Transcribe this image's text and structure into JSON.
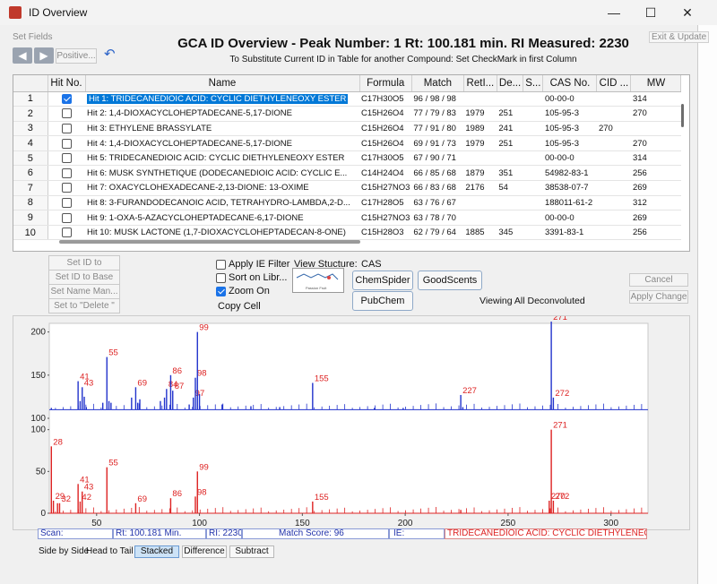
{
  "window": {
    "title": "ID Overview"
  },
  "toolbar": {
    "set_fields": "Set Fields",
    "positive": "Positive...",
    "exit_update": "Exit & Update"
  },
  "header": {
    "title": "GCA ID Overview - Peak Number: 1  Rt: 100.181 min.  RI Measured: 2230",
    "subtitle": "To Substitute Current ID in Table for another Compound: Set CheckMark in first Column"
  },
  "table": {
    "columns": [
      "",
      "Hit No.",
      "Name",
      "Formula",
      "Match",
      "RetI...",
      "De...",
      "S...",
      "CAS No.",
      "CID ...",
      "MW"
    ],
    "rows": [
      {
        "num": "1",
        "checked": true,
        "name": "Hit 1: TRIDECANEDIOIC ACID: CYCLIC DIETHYLENEOXY ESTER",
        "formula": "C17H30O5",
        "match": "96 / 98 / 98",
        "ret": "",
        "de": "",
        "s": "",
        "cas": "00-00-0",
        "cid": "",
        "mw": "314"
      },
      {
        "num": "2",
        "checked": false,
        "name": "Hit 2: 1,4-DIOXACYCLOHEPTADECANE-5,17-DIONE",
        "formula": "C15H26O4",
        "match": "77 / 79 / 83",
        "ret": "1979",
        "de": "251",
        "s": "",
        "cas": "105-95-3",
        "cid": "",
        "mw": "270"
      },
      {
        "num": "3",
        "checked": false,
        "name": "Hit 3: ETHYLENE BRASSYLATE",
        "formula": "C15H26O4",
        "match": "77 / 91 / 80",
        "ret": "1989",
        "de": "241",
        "s": "",
        "cas": "105-95-3",
        "cid": "270",
        "mw": ""
      },
      {
        "num": "4",
        "checked": false,
        "name": "Hit 4: 1,4-DIOXACYCLOHEPTADECANE-5,17-DIONE",
        "formula": "C15H26O4",
        "match": "69 / 91 / 73",
        "ret": "1979",
        "de": "251",
        "s": "",
        "cas": "105-95-3",
        "cid": "",
        "mw": "270"
      },
      {
        "num": "5",
        "checked": false,
        "name": "Hit 5: TRIDECANEDIOIC ACID: CYCLIC DIETHYLENEOXY ESTER",
        "formula": "C17H30O5",
        "match": "67 / 90 / 71",
        "ret": "",
        "de": "",
        "s": "",
        "cas": "00-00-0",
        "cid": "",
        "mw": "314"
      },
      {
        "num": "6",
        "checked": false,
        "name": "Hit 6: MUSK SYNTHETIQUE (DODECANEDIOIC ACID: CYCLIC E...",
        "formula": "C14H24O4",
        "match": "66 / 85 / 68",
        "ret": "1879",
        "de": "351",
        "s": "",
        "cas": "54982-83-1",
        "cid": "",
        "mw": "256"
      },
      {
        "num": "7",
        "checked": false,
        "name": "Hit 7: OXACYCLOHEXADECANE-2,13-DIONE: 13-OXIME",
        "formula": "C15H27NO3",
        "match": "66 / 83 / 68",
        "ret": "2176",
        "de": "54",
        "s": "",
        "cas": "38538-07-7",
        "cid": "",
        "mw": "269"
      },
      {
        "num": "8",
        "checked": false,
        "name": "Hit 8: 3-FURANDODECANOIC ACID, TETRAHYDRO-LAMBDA,2-D...",
        "formula": "C17H28O5",
        "match": "63 / 76 / 67",
        "ret": "",
        "de": "",
        "s": "",
        "cas": "188011-61-2",
        "cid": "",
        "mw": "312"
      },
      {
        "num": "9",
        "checked": false,
        "name": "Hit 9: 1-OXA-5-AZACYCLOHEPTADECANE-6,17-DIONE",
        "formula": "C15H27NO3",
        "match": "63 / 78 / 70",
        "ret": "",
        "de": "",
        "s": "",
        "cas": "00-00-0",
        "cid": "",
        "mw": "269"
      },
      {
        "num": "10",
        "checked": false,
        "name": "Hit 10: MUSK LACTONE (1,7-DIOXACYCLOHEPTADECAN-8-ONE)",
        "formula": "C15H28O3",
        "match": "62 / 79 / 64",
        "ret": "1885",
        "de": "345",
        "s": "",
        "cas": "3391-83-1",
        "cid": "",
        "mw": "256"
      }
    ]
  },
  "left_buttons": {
    "set_id_unknown": "Set ID to Unkno...",
    "set_id_base": "Set ID to Base",
    "set_name_man": "Set Name Man...",
    "set_delete": "Set to \"Delete \""
  },
  "options": {
    "apply_ie_filter": {
      "label": "Apply IE Filter",
      "checked": false
    },
    "sort_on_libr": {
      "label": "Sort on Libr...",
      "checked": false
    },
    "zoom_on": {
      "label": "Zoom On",
      "checked": true
    },
    "copy_cell": "Copy Cell"
  },
  "structure": {
    "view_label": "View Stucture:",
    "cas_label": "CAS",
    "img_caption": "Passion Fruit",
    "chemspider": "ChemSpider",
    "goodscents": "GoodScents",
    "pubchem": "PubChem",
    "viewing_text": "Viewing All Deconvoluted Ions"
  },
  "right_buttons": {
    "cancel": "Cancel",
    "apply_change": "Apply Change"
  },
  "status": {
    "scan": "Scan:",
    "rt": "Rt: 100.181 Min.",
    "ri": "RI: 2230",
    "match_score": "Match Score: 96",
    "ie": "IE:",
    "compound": "TRIDECANEDIOIC ACID: CYCLIC DIETHYLENEOX"
  },
  "view_tabs": {
    "side_by_side": "Side by Side",
    "head_to_tail": "Head to Tail",
    "stacked": "Stacked",
    "difference": "Difference",
    "subtract": "Subtract"
  },
  "colors": {
    "top_spectrum": "#2233cc",
    "bottom_spectrum": "#dd2222",
    "selection": "#0078d7"
  },
  "chart_data": [
    {
      "type": "bar",
      "series_role": "measured",
      "xlim": [
        27,
        318
      ],
      "ylim": [
        100,
        210
      ],
      "yticks": [
        100,
        150,
        200
      ],
      "xticks": [],
      "peaks": [
        {
          "x": 28,
          "y": 112
        },
        {
          "x": 29,
          "y": 110
        },
        {
          "x": 41,
          "y": 143,
          "label": "41"
        },
        {
          "x": 42,
          "y": 120
        },
        {
          "x": 43,
          "y": 136,
          "label": "43"
        },
        {
          "x": 44,
          "y": 125
        },
        {
          "x": 45,
          "y": 113
        },
        {
          "x": 53,
          "y": 118
        },
        {
          "x": 55,
          "y": 171,
          "label": "55"
        },
        {
          "x": 56,
          "y": 120
        },
        {
          "x": 57,
          "y": 118
        },
        {
          "x": 67,
          "y": 124
        },
        {
          "x": 69,
          "y": 136,
          "label": "69"
        },
        {
          "x": 70,
          "y": 118
        },
        {
          "x": 71,
          "y": 122
        },
        {
          "x": 81,
          "y": 120
        },
        {
          "x": 83,
          "y": 124
        },
        {
          "x": 84,
          "y": 134,
          "label": "84"
        },
        {
          "x": 86,
          "y": 150,
          "label": "86"
        },
        {
          "x": 87,
          "y": 132,
          "label": "87"
        },
        {
          "x": 95,
          "y": 116
        },
        {
          "x": 97,
          "y": 124,
          "label": "97"
        },
        {
          "x": 98,
          "y": 147,
          "label": "98"
        },
        {
          "x": 99,
          "y": 200,
          "label": "99"
        },
        {
          "x": 100,
          "y": 128
        },
        {
          "x": 111,
          "y": 116
        },
        {
          "x": 125,
          "y": 114
        },
        {
          "x": 139,
          "y": 113
        },
        {
          "x": 155,
          "y": 141,
          "label": "155"
        },
        {
          "x": 185,
          "y": 112
        },
        {
          "x": 199,
          "y": 112
        },
        {
          "x": 227,
          "y": 127,
          "label": "227"
        },
        {
          "x": 228,
          "y": 113
        },
        {
          "x": 271,
          "y": 212,
          "label": "271"
        },
        {
          "x": 272,
          "y": 124,
          "label": "272"
        }
      ]
    },
    {
      "type": "bar",
      "series_role": "library",
      "xlim": [
        27,
        318
      ],
      "ylim": [
        0,
        105
      ],
      "yticks": [
        0,
        50,
        100
      ],
      "xticks": [
        50,
        100,
        150,
        200,
        250,
        300
      ],
      "peaks": [
        {
          "x": 28,
          "y": 80,
          "label": "28"
        },
        {
          "x": 29,
          "y": 15,
          "label": "29"
        },
        {
          "x": 31,
          "y": 12
        },
        {
          "x": 32,
          "y": 12,
          "label": "32"
        },
        {
          "x": 41,
          "y": 35,
          "label": "41"
        },
        {
          "x": 42,
          "y": 14,
          "label": "42"
        },
        {
          "x": 43,
          "y": 26,
          "label": "43"
        },
        {
          "x": 55,
          "y": 55,
          "label": "55"
        },
        {
          "x": 69,
          "y": 12,
          "label": "69"
        },
        {
          "x": 86,
          "y": 18,
          "label": "86"
        },
        {
          "x": 98,
          "y": 20,
          "label": "98"
        },
        {
          "x": 99,
          "y": 50,
          "label": "99"
        },
        {
          "x": 155,
          "y": 14,
          "label": "155"
        },
        {
          "x": 227,
          "y": 4
        },
        {
          "x": 270,
          "y": 15,
          "label": "270"
        },
        {
          "x": 271,
          "y": 100,
          "label": "271"
        },
        {
          "x": 272,
          "y": 15,
          "label": "272"
        }
      ]
    }
  ]
}
